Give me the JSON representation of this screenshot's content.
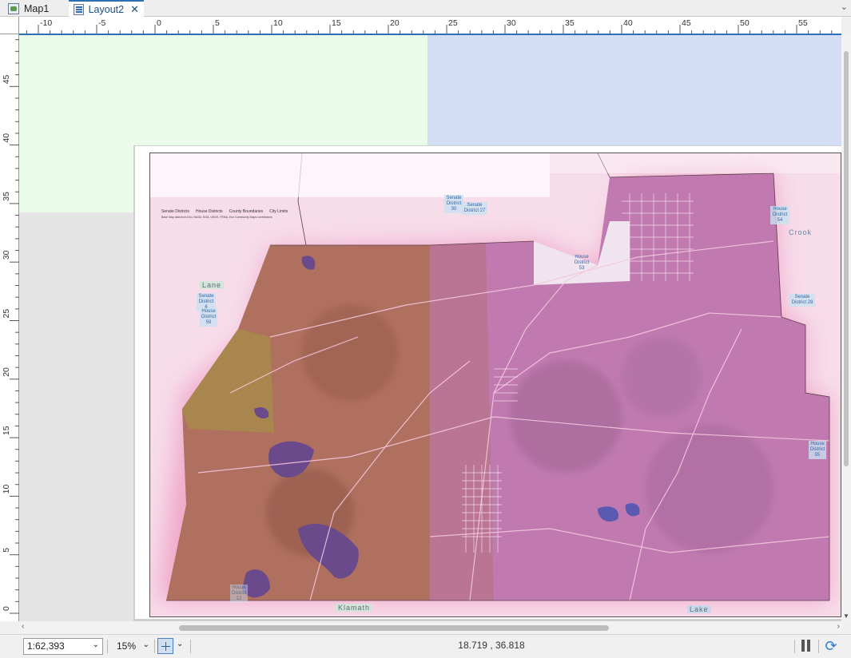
{
  "tabs": [
    {
      "label": "Map1",
      "icon": "map-icon",
      "active": false
    },
    {
      "label": "Layout2",
      "icon": "layout-icon",
      "active": true
    }
  ],
  "rulers": {
    "horizontal_labels": [
      "-10",
      "-5",
      "0",
      "5",
      "10",
      "15",
      "20",
      "25",
      "30",
      "35",
      "40",
      "45",
      "50",
      "55"
    ],
    "vertical_labels": [
      "45",
      "40",
      "35",
      "30",
      "25",
      "20",
      "15",
      "10",
      "5",
      "0"
    ]
  },
  "map": {
    "legend": {
      "items": [
        "Senate Districts",
        "House Districts",
        "County Boundaries",
        "City Limits"
      ],
      "note": "Base Map data from Esri, NASA, NGA, USGS, FEMA, Esri Community Maps contributors."
    },
    "county_labels": [
      "Lane",
      "Crook",
      "Klamath",
      "Lake"
    ],
    "district_labels": [
      "Senate District 27",
      "Senate District 28",
      "Senate District 30",
      "Senate District 6",
      "House District 53",
      "House District 54",
      "House District 55",
      "House District 59",
      "House District 12"
    ]
  },
  "statusbar": {
    "scale": "1:62,393",
    "zoom": "15%",
    "coordinates": "18.719 , 36.818"
  },
  "colors": {
    "accent": "#2d6fb7",
    "green_zone": "#ebfbe9",
    "blue_zone": "#d3def5"
  }
}
